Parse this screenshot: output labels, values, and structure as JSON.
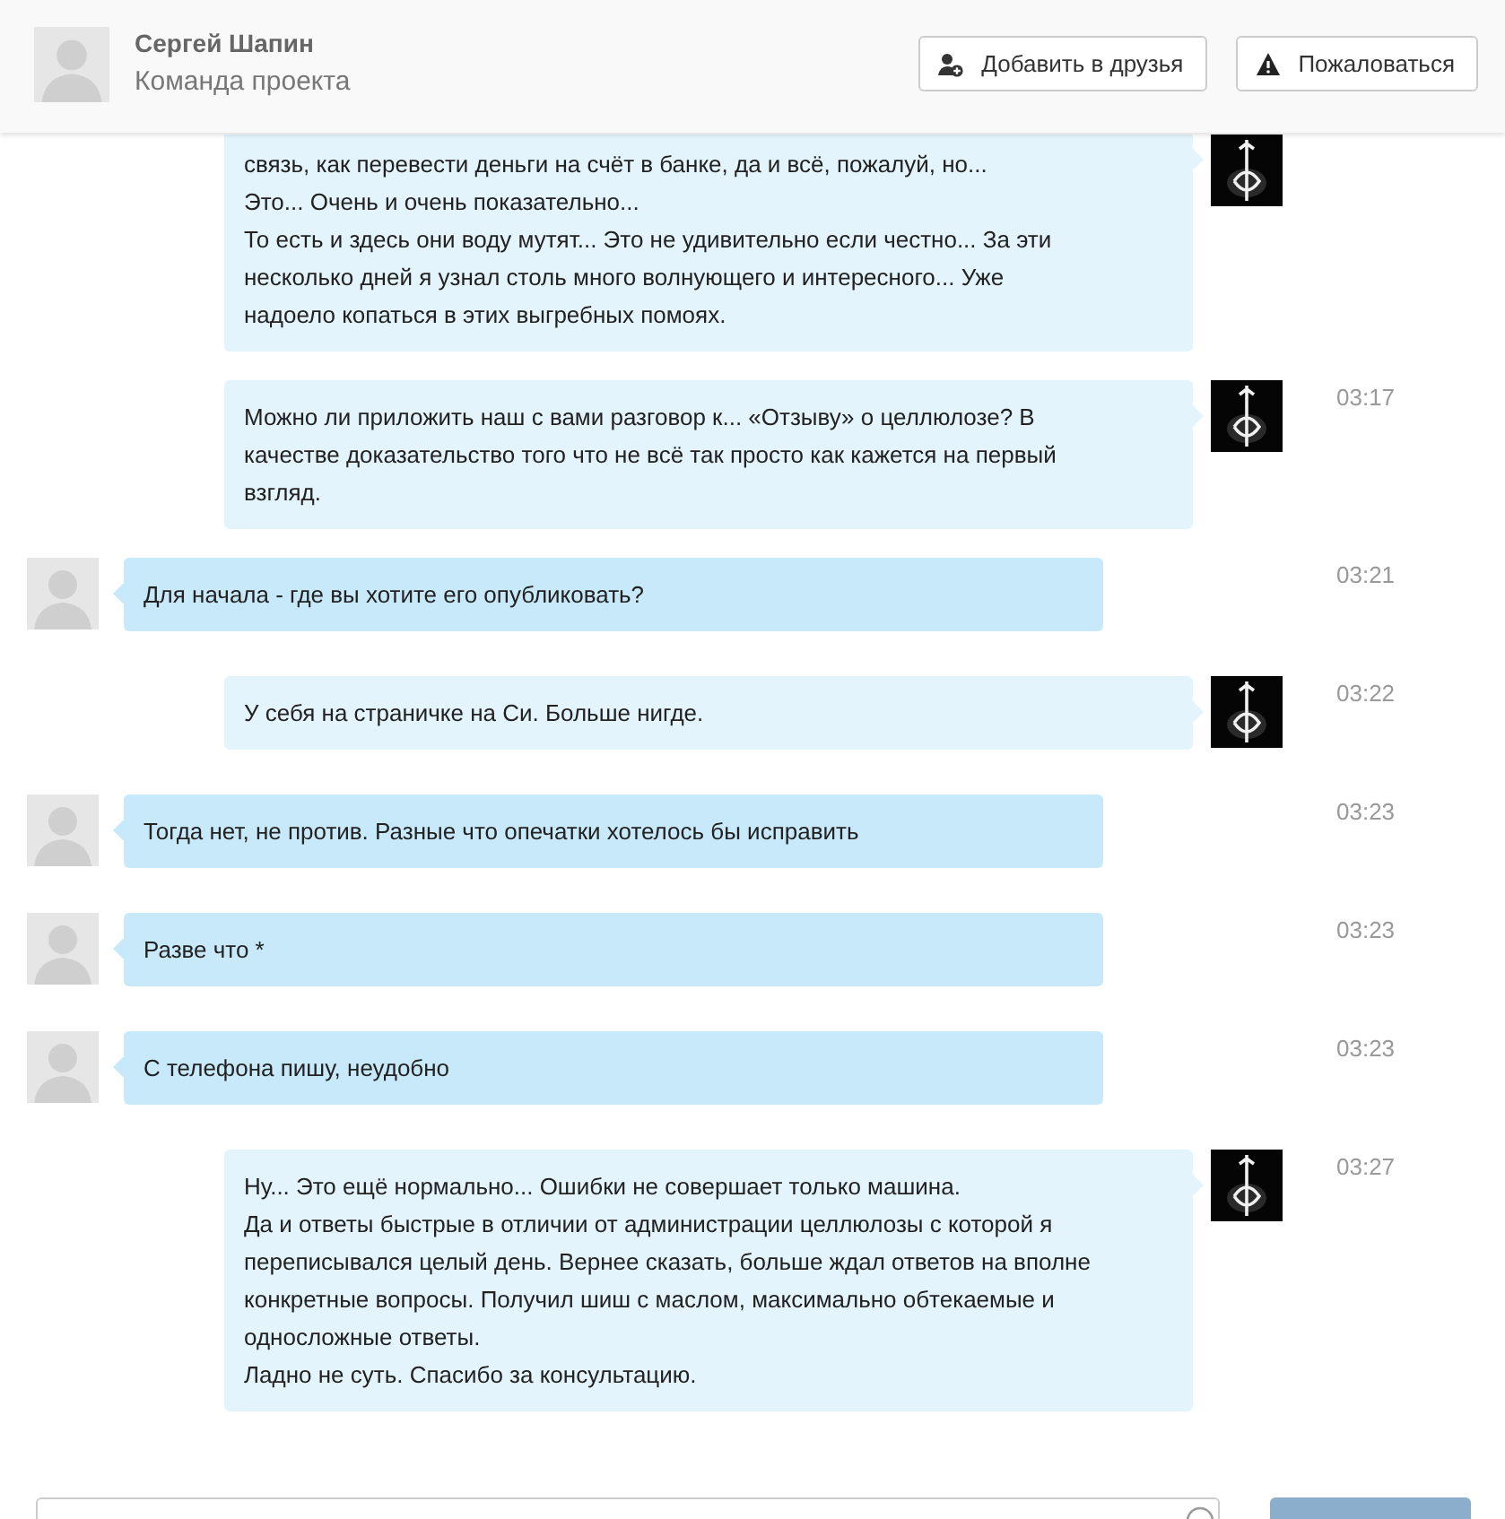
{
  "header": {
    "name": "Сергей Шапин",
    "subtitle": "Команда проекта",
    "buttons": [
      {
        "kind": "add-friend",
        "label": "Добавить в друзья"
      },
      {
        "kind": "report",
        "label": "Пожаловаться"
      }
    ]
  },
  "messages": [
    {
      "kind": "own",
      "lines": [
        "связь, как перевести деньги на счёт в банке, да и всё, пожалуй, но...",
        "Это... Очень и очень показательно...",
        "То есть и здесь они воду мутят... Это не удивительно если честно... За эти",
        "несколько дней я узнал столь много волнующего и интересного... Уже",
        "надоело копаться в этих выгребных помоях."
      ]
    },
    {
      "kind": "own",
      "time": "03:17",
      "lines": [
        "Можно ли приложить наш с вами разговор к... «Отзыву» о целлюлозе? В",
        "качестве доказательство того что не всё так просто как кажется на первый",
        "взгляд."
      ]
    },
    {
      "kind": "other",
      "time": "03:21",
      "lines": [
        "Для начала - где вы хотите его опубликовать?"
      ]
    },
    {
      "kind": "own",
      "time": "03:22",
      "lines": [
        "У себя на страничке на Си. Больше нигде."
      ]
    },
    {
      "kind": "other",
      "time": "03:23",
      "lines": [
        "Тогда нет, не против. Разные что опечатки хотелось бы исправить"
      ]
    },
    {
      "kind": "other",
      "time": "03:23",
      "lines": [
        "Разве что *"
      ]
    },
    {
      "kind": "other",
      "time": "03:23",
      "lines": [
        "С телефона пишу, неудобно"
      ]
    },
    {
      "kind": "own",
      "time": "03:27",
      "lines": [
        "Ну... Это ещё нормально... Ошибки не совершает только машина.",
        "Да и ответы быстрые в отличии от администрации целлюлозы с которой я",
        "переписывался целый день. Вернее сказать, больше ждал ответов на вполне",
        "конкретные вопросы. Получил шиш с маслом, максимально обтекаемые и",
        "односложные ответы.",
        "Ладно не суть. Спасибо за консультацию."
      ]
    }
  ]
}
